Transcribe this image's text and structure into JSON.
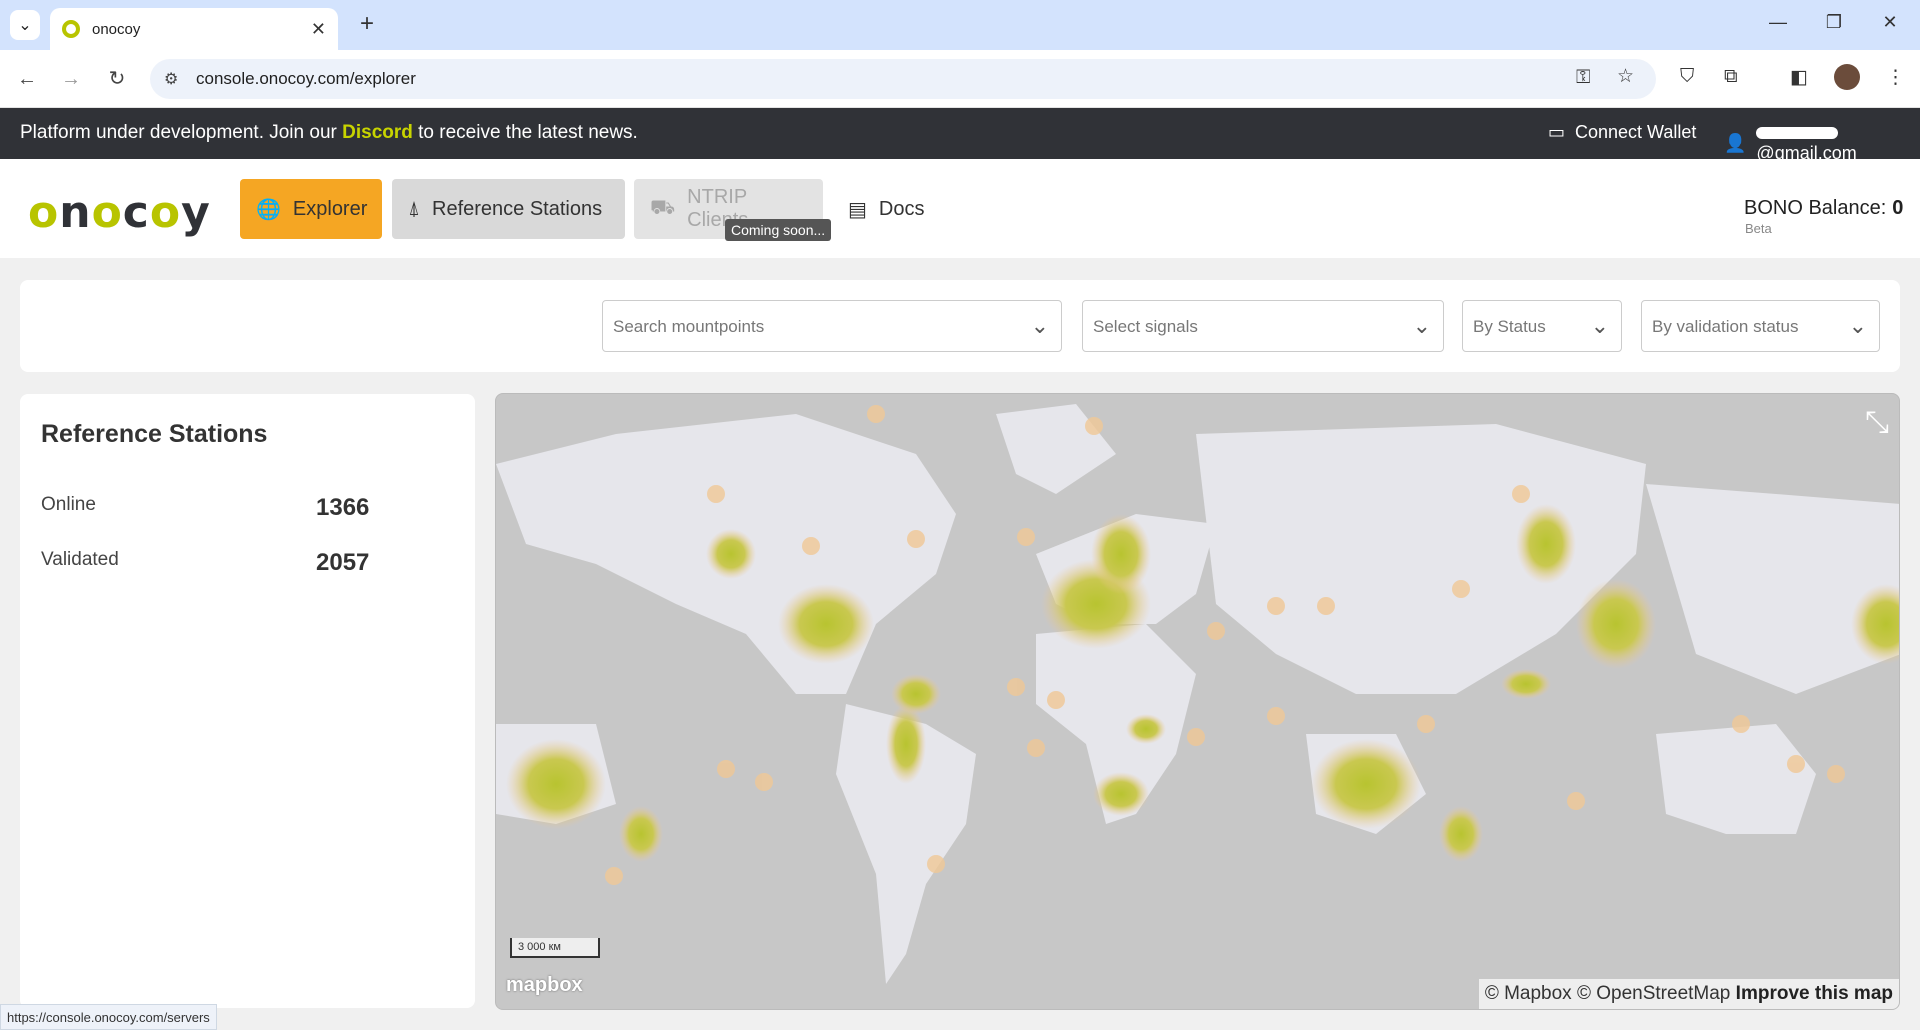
{
  "browser": {
    "tab_title": "onocoy",
    "url": "console.onocoy.com/explorer",
    "status_url": "https://console.onocoy.com/servers"
  },
  "announcement": {
    "prefix": "Platform under development. Join our ",
    "link": "Discord",
    "suffix": " to receive the latest news.",
    "connect_wallet": "Connect Wallet",
    "email_suffix": "@gmail.com"
  },
  "header": {
    "logo": "onocoy",
    "nav": {
      "explorer": "Explorer",
      "reference_stations": "Reference Stations",
      "ntrip_clients": "NTRIP Clients",
      "docs": "Docs"
    },
    "tooltip": "Coming soon...",
    "bono_label": "BONO Balance:",
    "bono_value": "0",
    "beta": "Beta"
  },
  "filters": {
    "search_mountpoints": "Search mountpoints",
    "select_signals": "Select signals",
    "by_status": "By Status",
    "by_validation_status": "By validation status"
  },
  "stats": {
    "title": "Reference Stations",
    "online_label": "Online",
    "online_value": "1366",
    "validated_label": "Validated",
    "validated_value": "2057"
  },
  "map": {
    "scale": "3 000 км",
    "logo": "mapbox",
    "attribution_mapbox": "© Mapbox",
    "attribution_osm": "© OpenStreetMap",
    "improve": "Improve this map",
    "colors": {
      "land": "#e6e6eb",
      "water": "#c7c7c7",
      "heat_core": "#b8c430",
      "heat_edge": "#f0c896"
    }
  }
}
